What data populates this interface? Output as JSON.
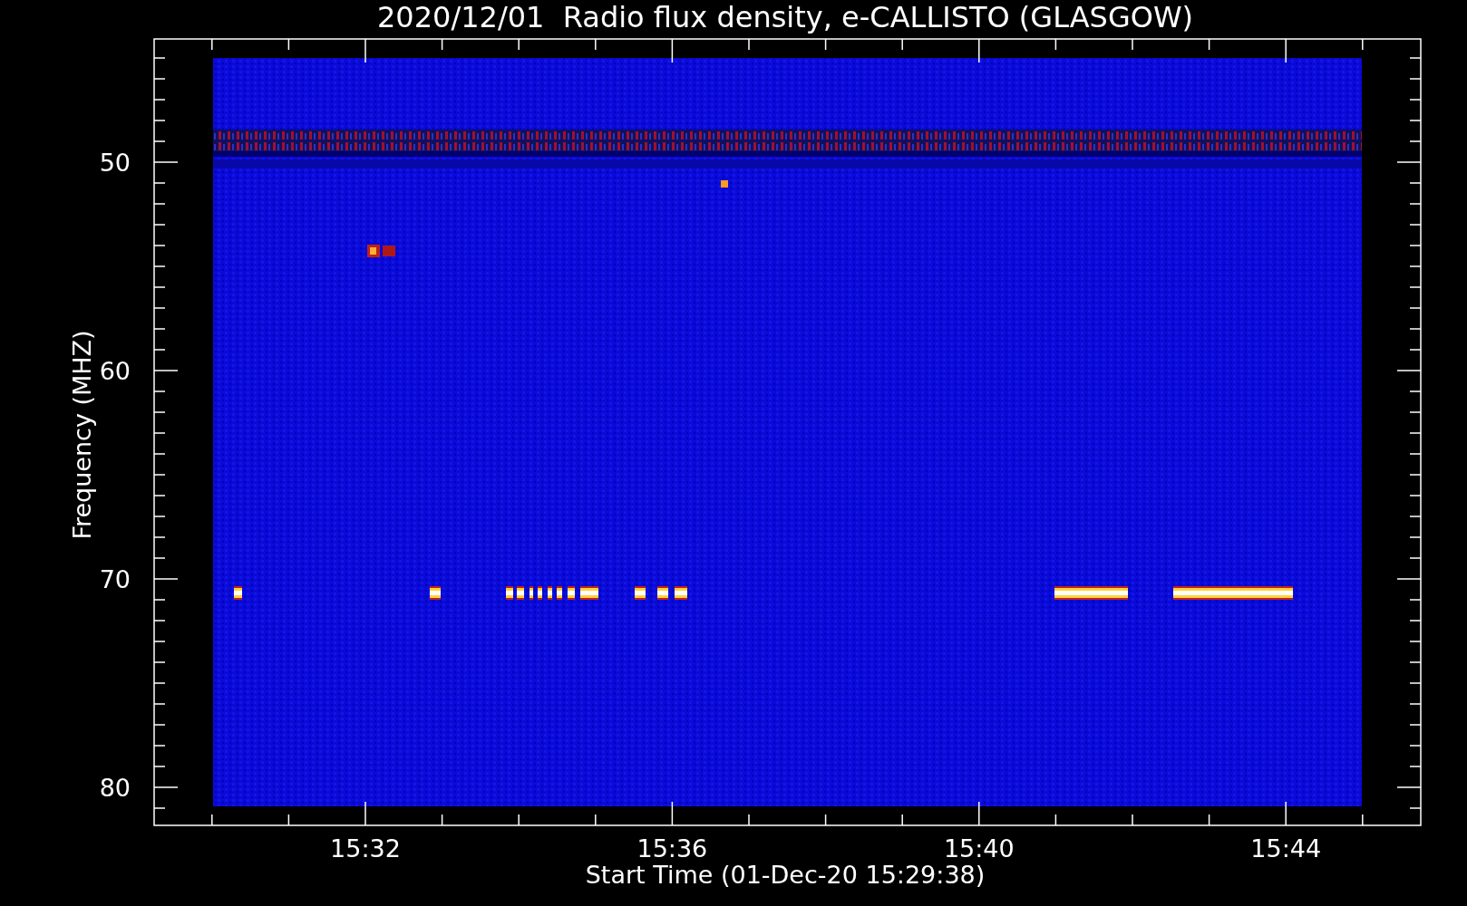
{
  "title": "2020/12/01  Radio flux density, e-CALLISTO (GLASGOW)",
  "y_axis": {
    "label": "Frequency (MHZ)",
    "ticks": [
      "50",
      "60",
      "70",
      "80"
    ]
  },
  "x_axis": {
    "label": "Start Time (01-Dec-20 15:29:38)",
    "ticks": [
      "15:32",
      "15:36",
      "15:40",
      "15:44"
    ]
  }
}
